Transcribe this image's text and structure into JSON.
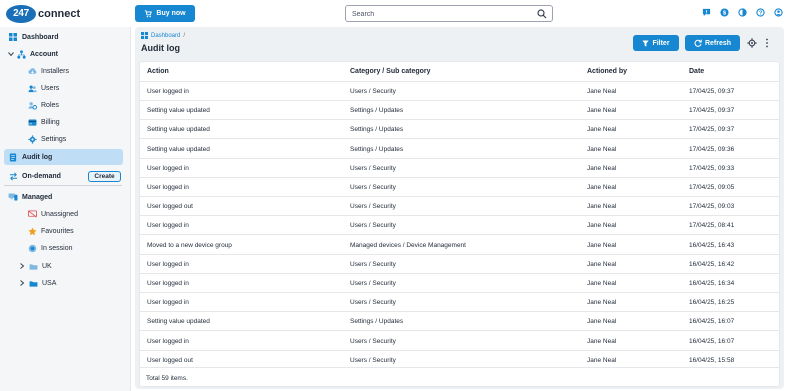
{
  "header": {
    "logo_badge": "247",
    "logo_text": "connect",
    "buy_label": "Buy now",
    "search_placeholder": "Search",
    "icons": [
      "message-icon",
      "dollar-icon",
      "contrast-icon",
      "help-icon",
      "user-icon"
    ]
  },
  "sidebar": {
    "dashboard": "Dashboard",
    "account": "Account",
    "installers": "Installers",
    "users": "Users",
    "roles": "Roles",
    "billing": "Billing",
    "settings": "Settings",
    "audit_log": "Audit log",
    "on_demand": "On-demand",
    "create": "Create",
    "managed": "Managed",
    "unassigned": "Unassigned",
    "favourites": "Favourites",
    "in_session": "In session",
    "uk": "UK",
    "usa": "USA"
  },
  "main": {
    "breadcrumb": "Dashboard",
    "breadcrumb_sep": "/",
    "title": "Audit log",
    "filter_label": "Filter",
    "refresh_label": "Refresh"
  },
  "table": {
    "headers": [
      "Action",
      "Category / Sub category",
      "Actioned by",
      "Date"
    ],
    "rows": [
      [
        "User logged in",
        "Users / Security",
        "Jane Neal",
        "17/04/25, 09:37"
      ],
      [
        "Setting value updated",
        "Settings / Updates",
        "Jane Neal",
        "17/04/25, 09:37"
      ],
      [
        "Setting value updated",
        "Settings / Updates",
        "Jane Neal",
        "17/04/25, 09:37"
      ],
      [
        "Setting value updated",
        "Settings / Updates",
        "Jane Neal",
        "17/04/25, 09:36"
      ],
      [
        "User logged in",
        "Users / Security",
        "Jane Neal",
        "17/04/25, 09:33"
      ],
      [
        "User logged in",
        "Users / Security",
        "Jane Neal",
        "17/04/25, 09:05"
      ],
      [
        "User logged out",
        "Users / Security",
        "Jane Neal",
        "17/04/25, 09:03"
      ],
      [
        "User logged in",
        "Users / Security",
        "Jane Neal",
        "17/04/25, 08:41"
      ],
      [
        "Moved to a new device group",
        "Managed devices / Device Management",
        "Jane Neal",
        "16/04/25, 16:43"
      ],
      [
        "User logged in",
        "Users / Security",
        "Jane Neal",
        "16/04/25, 16:42"
      ],
      [
        "User logged in",
        "Users / Security",
        "Jane Neal",
        "16/04/25, 16:34"
      ],
      [
        "User logged in",
        "Users / Security",
        "Jane Neal",
        "16/04/25, 16:25"
      ],
      [
        "Setting value updated",
        "Settings / Updates",
        "Jane Neal",
        "16/04/25, 16:07"
      ],
      [
        "User logged in",
        "Users / Security",
        "Jane Neal",
        "16/04/25, 16:07"
      ],
      [
        "User logged out",
        "Users / Security",
        "Jane Neal",
        "16/04/25, 15:58"
      ]
    ],
    "footer": "Total 59 items."
  },
  "colors": {
    "accent": "#1687d0",
    "active_bg": "#bfdef6",
    "sidebar_bg": "#f4f6f8",
    "main_bg": "#eef1f4"
  }
}
